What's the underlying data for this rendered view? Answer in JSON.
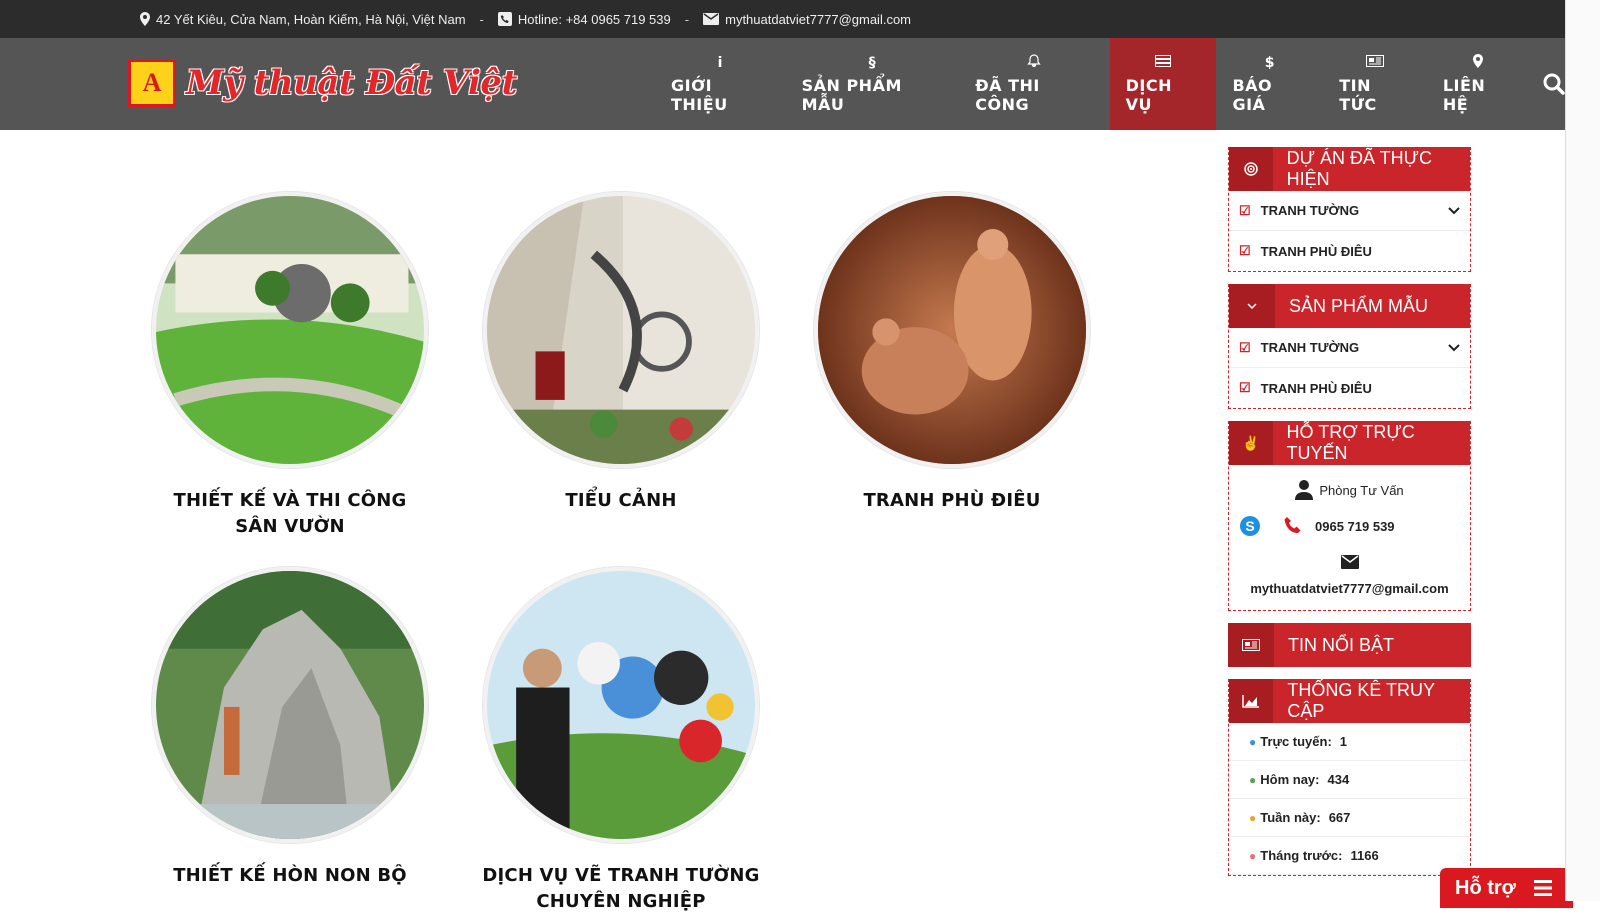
{
  "topbar": {
    "address": "42 Yết Kiêu, Cửa Nam, Hoàn Kiếm, Hà Nội, Việt Nam",
    "sep": "-",
    "hotline": "Hotline: +84 0965 719 539",
    "email": "mythuatdatviet7777@gmail.com"
  },
  "logo": {
    "mark": "A",
    "text": "Mỹ thuật Đất Việt"
  },
  "nav": {
    "items": [
      {
        "label": "GIỚI THIỆU",
        "icon": "i"
      },
      {
        "label": "SẢN PHẨM MẪU",
        "icon": "§"
      },
      {
        "label": "ĐÃ THI CÔNG",
        "icon": "🔔"
      },
      {
        "label": "DỊCH VỤ",
        "icon": "☰"
      },
      {
        "label": "BÁO GIÁ",
        "icon": "$"
      },
      {
        "label": "TIN TỨC",
        "icon": "▤"
      },
      {
        "label": "LIÊN HỆ",
        "icon": "●"
      }
    ],
    "active": "DỊCH VỤ"
  },
  "services": [
    {
      "title": "THIẾT KẾ VÀ THI CÔNG SÂN VƯỜN"
    },
    {
      "title": "TIỂU CẢNH"
    },
    {
      "title": "TRANH PHÙ ĐIÊU"
    },
    {
      "title": "THIẾT KẾ HÒN NON BỘ"
    },
    {
      "title": "DỊCH VỤ VẼ TRANH TƯỜNG CHUYÊN NGHIỆP"
    }
  ],
  "sidebar": {
    "projects": {
      "title": "DỰ ÁN ĐÃ THỰC HIỆN",
      "items": [
        "TRANH TƯỜNG",
        "TRANH PHÙ ĐIÊU"
      ]
    },
    "samples": {
      "title": "SẢN PHẨM MẪU",
      "items": [
        "TRANH TƯỜNG",
        "TRANH PHÙ ĐIÊU"
      ]
    },
    "support": {
      "title": "HỖ TRỢ TRỰC TUYẾN",
      "dept": "Phòng Tư Vấn",
      "phone": "0965 719 539",
      "email": "mythuatdatviet7777@gmail.com"
    },
    "news": {
      "title": "TIN NỔI BẬT"
    },
    "stats": {
      "title": "THỐNG KÊ TRUY CẬP",
      "rows": [
        {
          "label": "Trực tuyến:",
          "value": "1"
        },
        {
          "label": "Hôm nay:",
          "value": "434"
        },
        {
          "label": "Tuần này:",
          "value": "667"
        },
        {
          "label": "Tháng trước:",
          "value": "1166"
        }
      ]
    }
  },
  "float_button": {
    "label": "Hỗ trợ"
  },
  "colors": {
    "brand_red": "#c9252b",
    "topbar": "#2c2c2c",
    "header": "#555555",
    "active_nav": "#a4262b"
  }
}
